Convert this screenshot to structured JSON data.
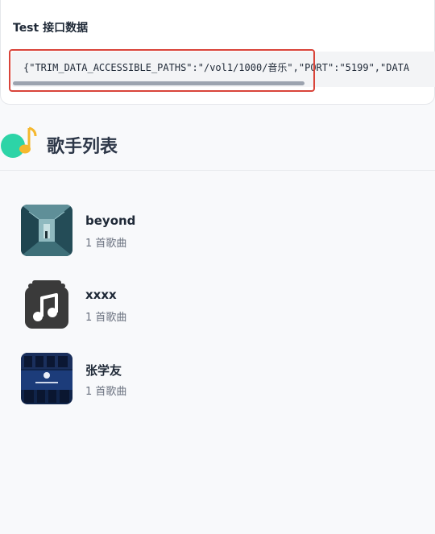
{
  "test_panel": {
    "title": "Test 接口数据",
    "code": "{\"TRIM_DATA_ACCESSIBLE_PATHS\":\"/vol1/1000/音乐\",\"PORT\":\"5199\",\"DATA"
  },
  "header": {
    "title": "歌手列表",
    "icon": "music-note-logo-icon"
  },
  "artists": [
    {
      "name": "beyond",
      "count": "1 首歌曲",
      "thumb": "corridor-photo"
    },
    {
      "name": "xxxx",
      "count": "1 首歌曲",
      "thumb": "music-note-icon"
    },
    {
      "name": "张学友",
      "count": "1 首歌曲",
      "thumb": "album-cover-photo"
    }
  ],
  "colors": {
    "highlight": "#d9443a",
    "logo_circle": "#2dd4a7",
    "logo_note": "#f5b82e"
  }
}
